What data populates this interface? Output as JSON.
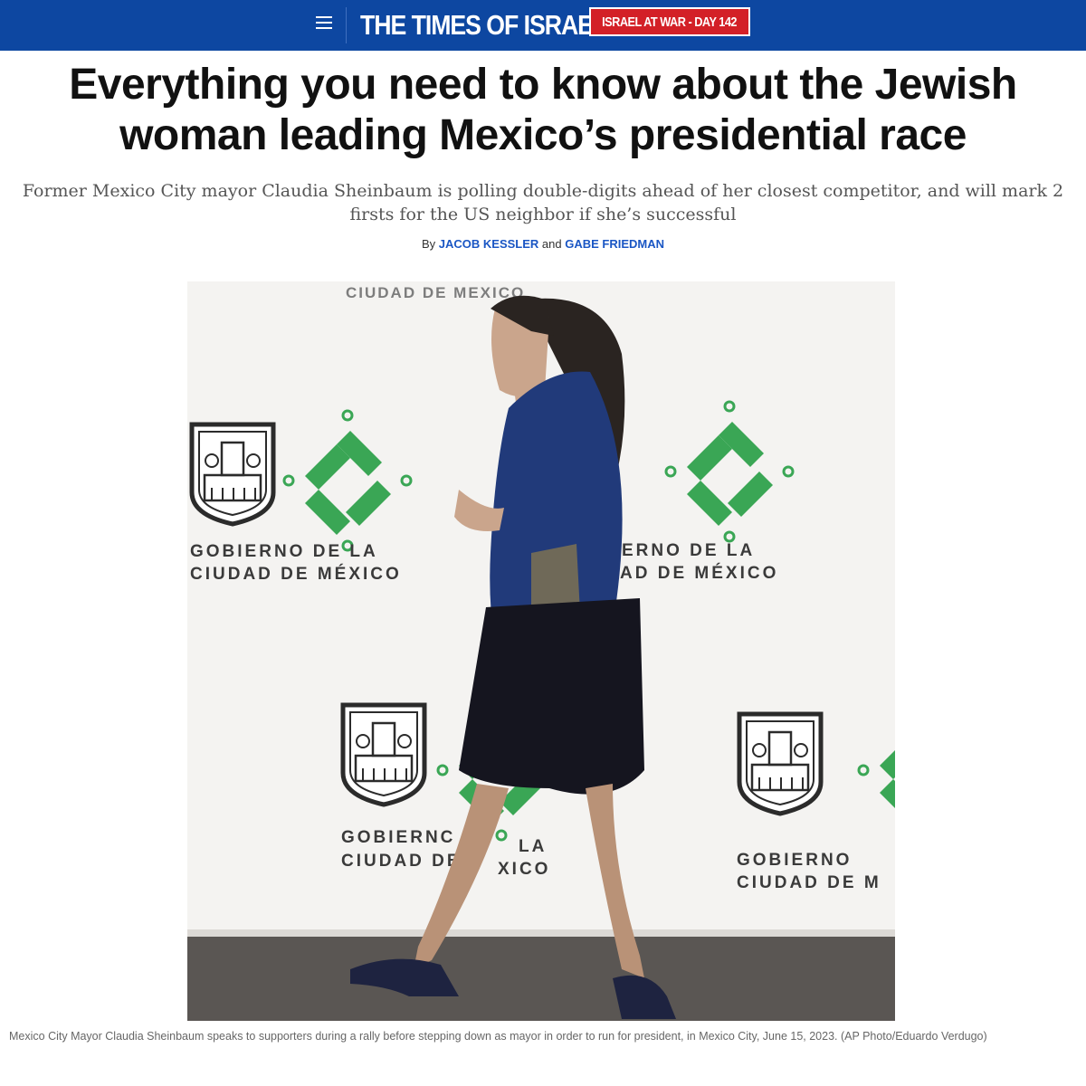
{
  "header": {
    "menu_icon": "hamburger-menu-icon",
    "logo_text": "THE TIMES OF ISRAEL",
    "badge_text": "ISRAEL AT WAR - DAY 142",
    "bg_color": "#0d47a1",
    "badge_color": "#d32027"
  },
  "article": {
    "headline_line1": "Everything you need to know about the Jewish",
    "headline_line2": "woman leading Mexico’s presidential race",
    "subhead": "Former Mexico City mayor Claudia Sheinbaum is polling double-digits ahead of her closest competitor, and will mark 2 firsts for the US neighbor if she’s successful",
    "byline_prefix": "By",
    "author1": "JACOB KESSLER",
    "byline_and": "and",
    "author2": "GABE FRIEDMAN",
    "link_color": "#1a56c4"
  },
  "photo": {
    "backdrop_top_text": "CIUDAD DE MEXICO",
    "org_line1": "GOBIERNO DE LA",
    "org_line2": "CIUDAD DE MÉXICO",
    "org_line1_partial_right": "ERNO DE LA",
    "org_line2_partial_right": "AD DE MÉXICO",
    "org_line1_partial_mid": "GOBIERNC",
    "org_line1_partial_mid_b": "LA",
    "org_line2_partial_mid": "CIUDAD DE",
    "org_line2_partial_mid_b": "XICO",
    "org_line1_partial_br": "GOBIERNO",
    "org_line2_partial_br": "CIUDAD DE M",
    "logo_green": "#3aa655"
  },
  "caption": "Mexico City Mayor Claudia Sheinbaum speaks to supporters during a rally before stepping down as mayor in order to run for president, in Mexico City, June 15, 2023. (AP Photo/Eduardo Verdugo)"
}
